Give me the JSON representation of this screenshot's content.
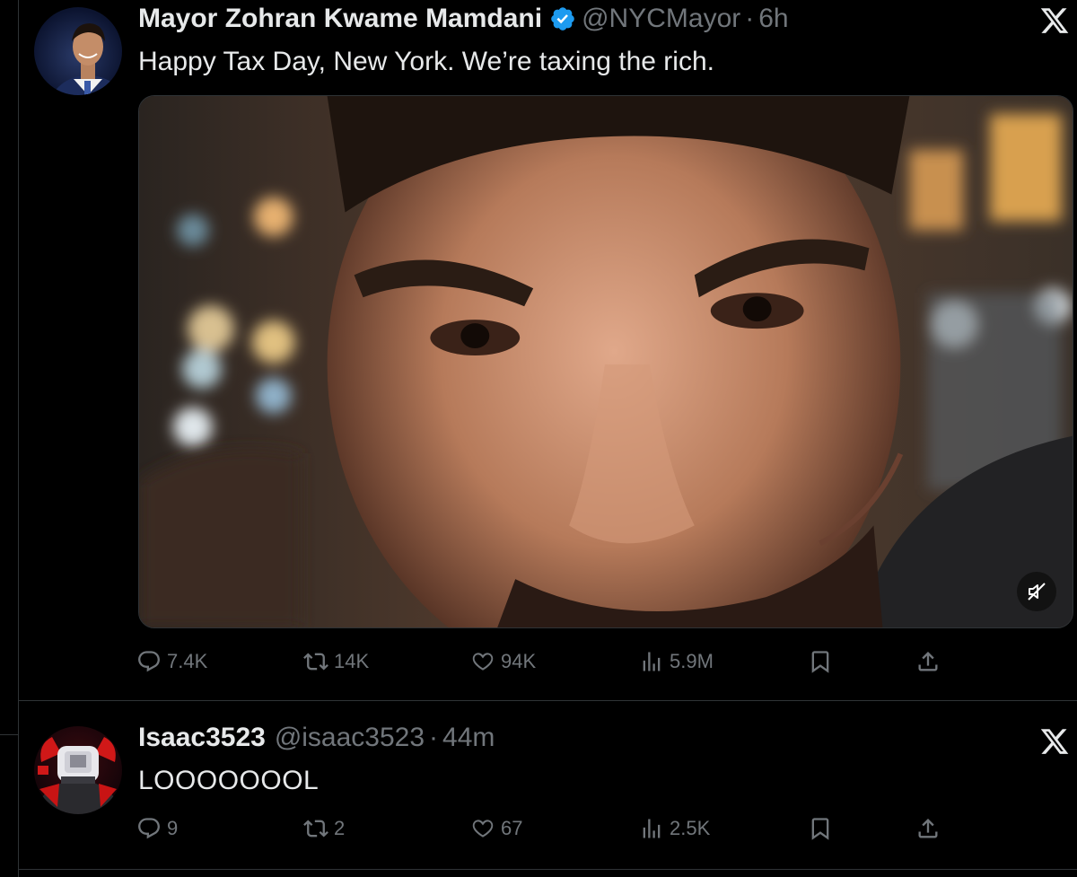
{
  "tweets": [
    {
      "author": {
        "name": "Mayor Zohran Kwame Mamdani",
        "handle": "@NYCMayor",
        "verified": true,
        "age": "6h"
      },
      "text": "Happy Tax Day, New York. We’re taxing the rich.",
      "media": {
        "type": "video",
        "muted": true
      },
      "stats": {
        "replies": "7.4K",
        "reposts": "14K",
        "likes": "94K",
        "views": "5.9M"
      }
    },
    {
      "author": {
        "name": "Isaac3523",
        "handle": "@isaac3523",
        "verified": false,
        "age": "44m"
      },
      "text": "LOOOOOOOL",
      "stats": {
        "replies": "9",
        "reposts": "2",
        "likes": "67",
        "views": "2.5K"
      }
    }
  ],
  "separator": "·",
  "colors": {
    "background": "#000000",
    "text": "#e7e9ea",
    "muted": "#71767b",
    "verified": "#1d9bf0",
    "border": "#2f3336"
  },
  "icons": [
    "reply-icon",
    "repost-icon",
    "like-icon",
    "views-icon",
    "bookmark-icon",
    "share-icon",
    "x-logo-icon",
    "verified-badge-icon",
    "mute-icon"
  ]
}
